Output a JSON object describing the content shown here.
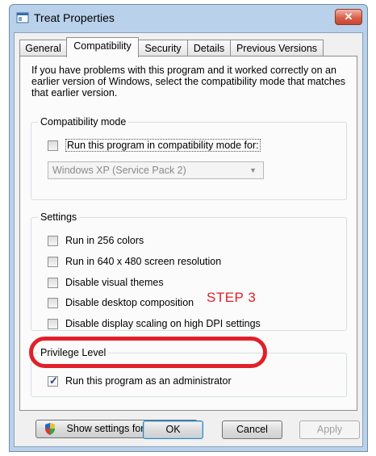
{
  "window": {
    "title": "Treat Properties",
    "close_glyph": "✕"
  },
  "tabs": [
    {
      "label": "General"
    },
    {
      "label": "Compatibility"
    },
    {
      "label": "Security"
    },
    {
      "label": "Details"
    },
    {
      "label": "Previous Versions"
    }
  ],
  "intro_text": "If you have problems with this program and it worked correctly on an earlier version of Windows, select the compatibility mode that matches that earlier version.",
  "compatibility_mode": {
    "legend": "Compatibility mode",
    "checkbox_label": "Run this program in compatibility mode for:",
    "checked": false,
    "select_value": "Windows XP (Service Pack 2)"
  },
  "settings": {
    "legend": "Settings",
    "options": [
      {
        "label": "Run in 256 colors",
        "checked": false
      },
      {
        "label": "Run in 640 x 480 screen resolution",
        "checked": false
      },
      {
        "label": "Disable visual themes",
        "checked": false
      },
      {
        "label": "Disable desktop composition",
        "checked": false
      },
      {
        "label": "Disable display scaling on high DPI settings",
        "checked": false
      }
    ]
  },
  "privilege": {
    "legend": "Privilege Level",
    "checkbox_label": "Run this program as an administrator",
    "checked": true,
    "check_glyph": "✓"
  },
  "annotation": {
    "step_label": "STEP 3",
    "color": "#e0202a"
  },
  "show_settings_button": "Show settings for all users",
  "buttons": {
    "ok": "OK",
    "cancel": "Cancel",
    "apply": "Apply"
  }
}
